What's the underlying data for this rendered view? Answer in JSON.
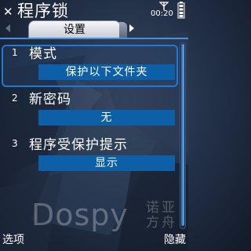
{
  "status": {
    "clock": "00:20",
    "signal_icon": "signal-icon",
    "battery_icon": "battery-icon"
  },
  "header": {
    "close_icon": "close-icon",
    "close_glyph": "✕",
    "title": "程序锁",
    "active_tab": "设置"
  },
  "settings": {
    "items": [
      {
        "number": "1",
        "label": "模式",
        "value": "保护以下文件夹"
      },
      {
        "number": "2",
        "label": "新密码",
        "value": "无"
      },
      {
        "number": "3",
        "label": "程序受保护提示",
        "value": "显示"
      }
    ]
  },
  "watermark": {
    "text": "Dospy",
    "sub": "诺亚方舟"
  },
  "softkeys": {
    "left": "选项",
    "right": "隐藏"
  },
  "colors": {
    "accent": "#1e7ad6",
    "value_bg": "#0d60a8"
  }
}
